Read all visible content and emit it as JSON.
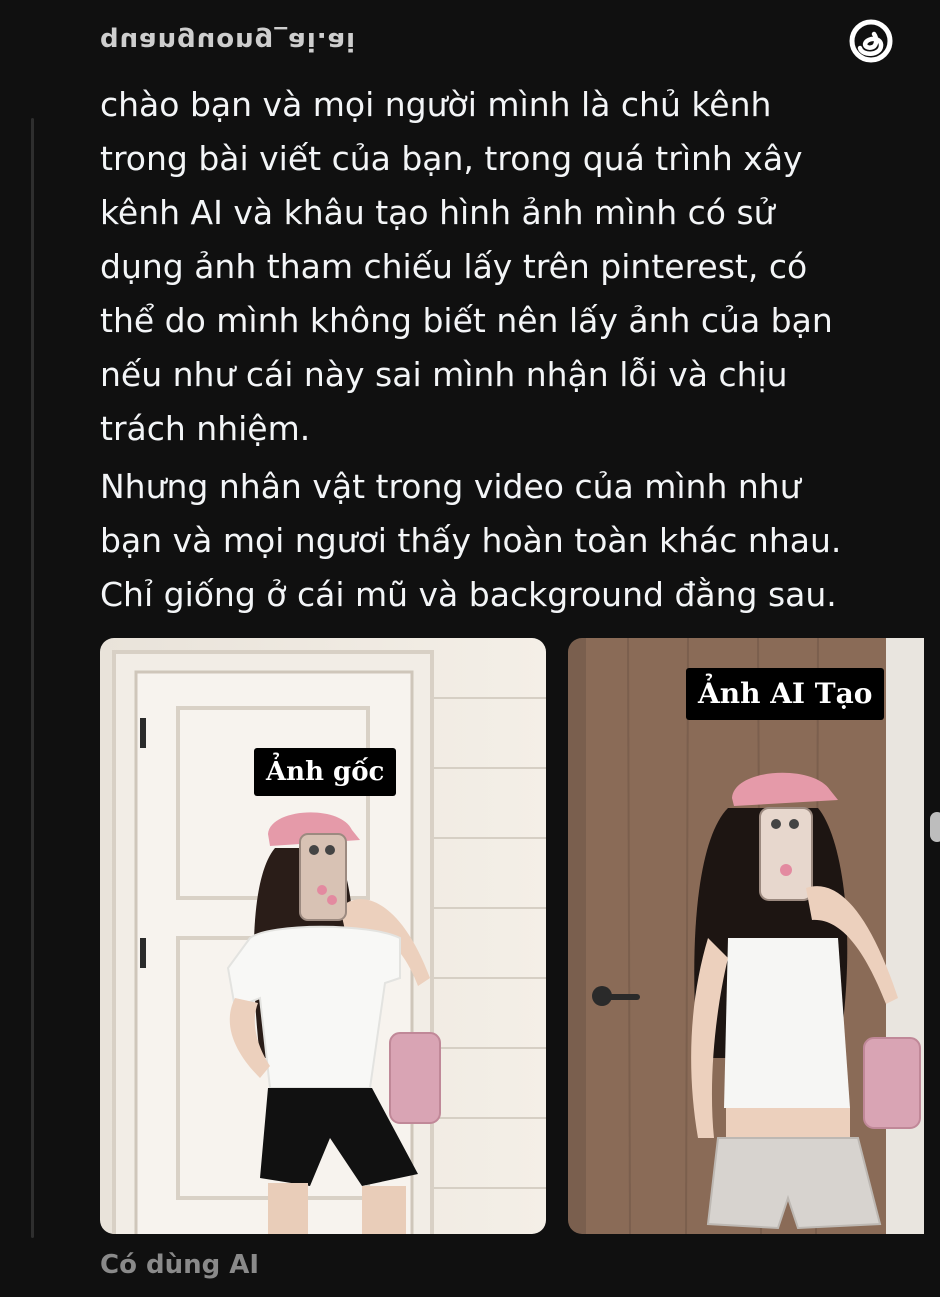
{
  "header": {
    "username": "quanguong_ai.ai",
    "logo_icon": "threads-logo-icon"
  },
  "post": {
    "paragraph_1": "chào bạn và mọi người mình là chủ kênh\ntrong bài viết của bạn, trong quá trình xây\nkênh AI và khâu tạo hình ảnh mình có sử\ndụng ảnh tham chiếu lấy trên pinterest, có\nthể do mình không biết nên lấy ảnh của bạn\nnếu như cái này sai mình nhận lỗi và chịu\ntrách nhiệm.",
    "paragraph_2": "Nhưng nhân vật trong video của mình như\nbạn và mọi ngươi thấy hoàn toàn khác nhau.\nChỉ giống ở cái mũ và background đằng sau."
  },
  "media": {
    "original_label": "Ảnh gốc",
    "ai_label": "Ảnh AI Tạo"
  },
  "footer": {
    "ai_tag": "Có dùng AI"
  },
  "colors": {
    "background": "#101010",
    "text": "#f3f5f7",
    "muted": "#8a8a8a",
    "cap_pink": "#e59aa9"
  }
}
